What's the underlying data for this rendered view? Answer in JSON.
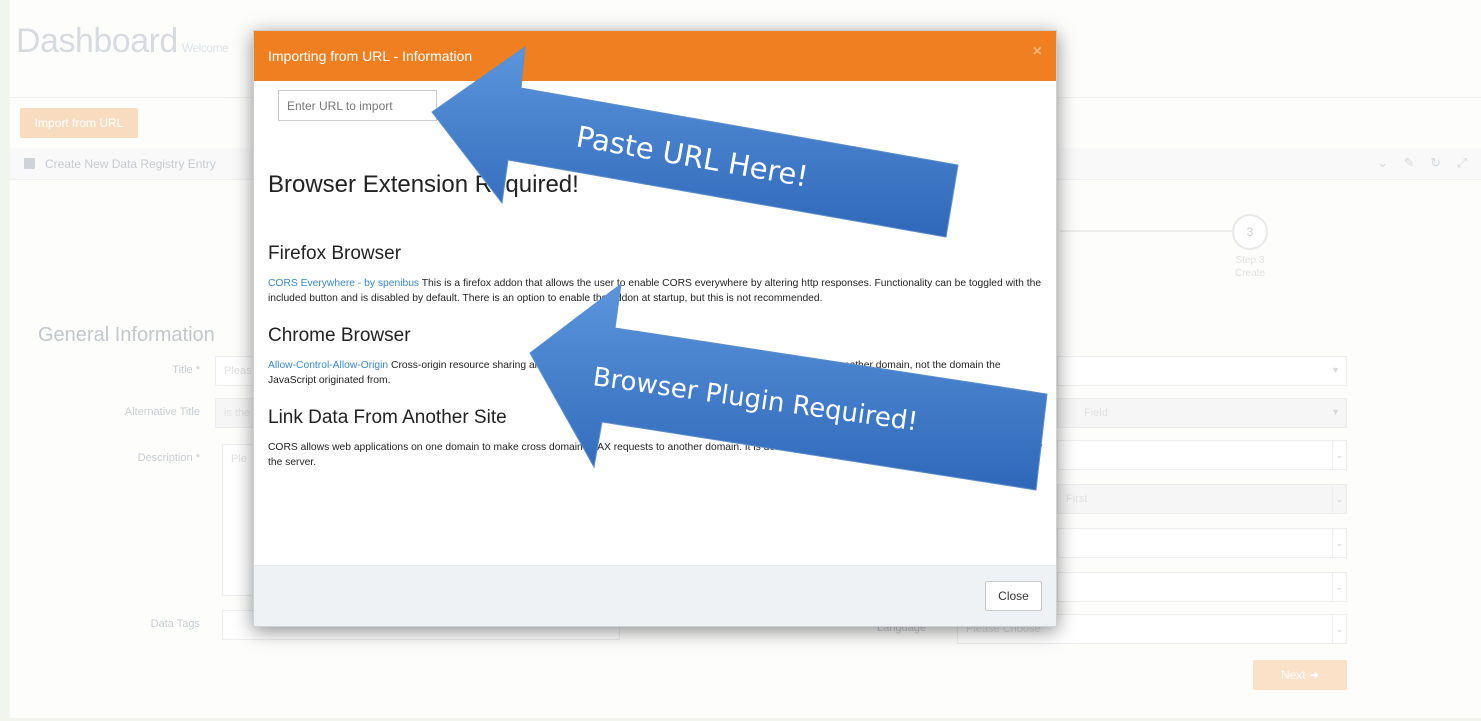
{
  "dashboard": {
    "title": "Dashboard",
    "welcome": "Welcome",
    "import_button": "Import from URL",
    "panel_title": "Create New Data Registry Entry",
    "panel_tools": "⌄ ✎ ↻ ⤢",
    "wizard": {
      "step_number": "3",
      "step_label": "Step 3",
      "step_name": "Create"
    },
    "general_information": "General Information",
    "form": {
      "title_label": "Title",
      "title_placeholder": "Pleas",
      "alt_title_label": "Alternative Title",
      "alt_title_placeholder": "is the",
      "description_label": "Description",
      "description_placeholder": "Ple",
      "data_tags_label": "Data Tags",
      "language_label": "Language",
      "language_placeholder": "Please Choose",
      "right_select_2": "Field",
      "right_select_4": "First"
    },
    "next_button": "Next"
  },
  "modal": {
    "title": "Importing from URL - Information",
    "close_x": "×",
    "url_placeholder": "Enter URL to import",
    "heading": "Browser Extension Required!",
    "firefox": {
      "heading": "Firefox Browser",
      "link": "CORS Everywhere - by spenibus",
      "text": " This is a firefox addon that allows the user to enable CORS everywhere by altering http responses. Functionality can be toggled with the included button and is disabled by default. There is an option to enable the addon at startup, but this is not recommended."
    },
    "chrome": {
      "heading": "Chrome Browser",
      "link": "Allow-Control-Allow-Origin",
      "text": " Cross-origin resource sharing allows a script running in a web page to make XMLHttpRequests to another domain, not the domain the JavaScript originated from."
    },
    "link_data": {
      "heading": "Link Data From Another Site",
      "text": "CORS allows web applications on one domain to make cross domain AJAX requests to another domain. It is dead simple, requires a single response header to be sent by the server."
    },
    "close_button": "Close"
  },
  "callouts": {
    "paste_url": "Paste URL Here!",
    "plugin_required": "Browser Plugin Required!",
    "color": "#3e7ccb"
  }
}
